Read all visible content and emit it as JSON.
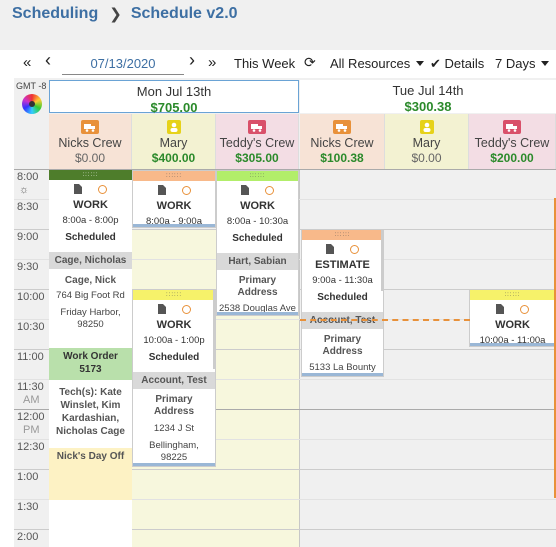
{
  "breadcrumb": {
    "root": "Scheduling",
    "current": "Schedule v2.0"
  },
  "toolbar": {
    "first": "«",
    "prev": "‹",
    "date": "07/13/2020",
    "next": "›",
    "last": "»",
    "range": "This Week",
    "refresh": "⟳",
    "resources": "All Resources",
    "details_check": "✔",
    "details": "Details",
    "days": "7 Days"
  },
  "timezone": "GMT -8",
  "days": [
    {
      "name": "Mon Jul 13th",
      "total": "$705.00",
      "resources": [
        {
          "name": "Nicks Crew",
          "amount": "$0.00",
          "icon": "truck-icon",
          "color": "#e8913a"
        },
        {
          "name": "Mary",
          "amount": "$400.00",
          "icon": "person-icon",
          "color": "#e6d21a"
        },
        {
          "name": "Teddy's Crew",
          "amount": "$305.00",
          "icon": "truck-icon",
          "color": "#d9506a"
        }
      ]
    },
    {
      "name": "Tue Jul 14th",
      "total": "$300.38",
      "resources": [
        {
          "name": "Nicks Crew",
          "amount": "$100.38",
          "icon": "truck-icon",
          "color": "#e8913a"
        },
        {
          "name": "Mary",
          "amount": "$0.00",
          "icon": "person-icon",
          "color": "#e6d21a"
        },
        {
          "name": "Teddy's Crew",
          "amount": "$200.00",
          "icon": "truck-icon",
          "color": "#d9506a"
        }
      ]
    }
  ],
  "times": [
    "8:00",
    "8:30",
    "9:00",
    "9:30",
    "10:00",
    "10:30",
    "11:00",
    "11:30",
    "AM",
    "12:00",
    "PM",
    "12:30",
    "1:00",
    "1:30",
    "2:00"
  ],
  "events": {
    "nick": {
      "grip": "::::::",
      "title": "WORK",
      "time": "8:00a - 8:00p",
      "status": "Scheduled",
      "customer": "Cage, Nicholas",
      "contact": "Cage, Nick",
      "address": "764 Big Foot Rd",
      "city": "Friday Harbor, 98250",
      "work_order": "Work Order",
      "work_order_no": "5173",
      "techs": "Tech(s): Kate Winslet, Kim Kardashian, Nicholas Cage",
      "dayoff": "Nick's Day Off"
    },
    "mary1": {
      "grip": "::::::",
      "title": "WORK",
      "time": "8:00a - 9:00a"
    },
    "teddy1": {
      "grip": "::::::",
      "title": "WORK",
      "time": "8:00a - 10:30a",
      "status": "Scheduled",
      "customer": "Hart, Sabian",
      "addr": "Primary Address",
      "street": "2538 Douglas Ave"
    },
    "mary2": {
      "grip": "::::::",
      "title": "WORK",
      "time": "10:00a - 1:00p",
      "status": "Scheduled",
      "customer": "Account, Test",
      "addr": "Primary Address",
      "street": "1234 J St",
      "city": "Bellingham, 98225"
    },
    "est": {
      "grip": "::::::",
      "title": "ESTIMATE",
      "time": "9:00a - 11:30a",
      "status": "Scheduled",
      "customer": "Account, Test",
      "addr": "Primary Address",
      "street": "5133 La Bounty"
    },
    "teddy2": {
      "grip": "::::::",
      "title": "WORK",
      "time": "10:00a - 11:00a"
    }
  },
  "colors": {
    "brand": "#3d6fa3",
    "money": "#2b8a2b",
    "now": "#e8913a",
    "today_border": "#6aa3d5"
  }
}
